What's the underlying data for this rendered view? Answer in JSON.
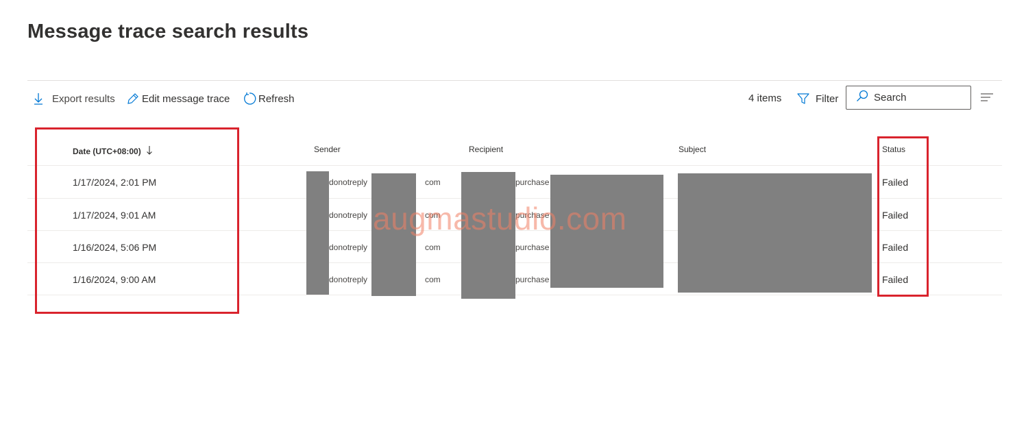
{
  "page": {
    "title": "Message trace search results"
  },
  "toolbar": {
    "export_label": "Export results",
    "edit_label": "Edit message trace",
    "refresh_label": "Refresh",
    "items_count": "4 items",
    "filter_label": "Filter",
    "search_placeholder": "Search"
  },
  "table": {
    "columns": {
      "date": "Date (UTC+08:00)",
      "sender": "Sender",
      "recipient": "Recipient",
      "subject": "Subject",
      "status": "Status"
    },
    "rows": [
      {
        "date": "1/17/2024, 2:01 PM",
        "sender_local": "donotreply",
        "sender_tld": "com",
        "recipient_local": "purchase",
        "status": "Failed"
      },
      {
        "date": "1/17/2024, 9:01 AM",
        "sender_local": "donotreply",
        "sender_tld": "com",
        "recipient_local": "purchase",
        "status": "Failed"
      },
      {
        "date": "1/16/2024, 5:06 PM",
        "sender_local": "donotreply",
        "sender_tld": "com",
        "recipient_local": "purchase",
        "status": "Failed"
      },
      {
        "date": "1/16/2024, 9:00 AM",
        "sender_local": "donotreply",
        "sender_tld": "com",
        "recipient_local": "purchase",
        "status": "Failed"
      }
    ]
  },
  "watermark": "augmastudio.com",
  "colors": {
    "annotation": "#d9232d",
    "redaction": "#808080",
    "accent": "#0078d4"
  }
}
